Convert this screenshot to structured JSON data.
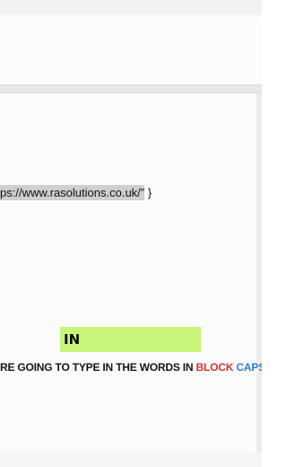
{
  "document": {
    "code_line_url": "ps://www.rasolutions.co.uk/”",
    "code_line_tail": " }"
  },
  "overlay": {
    "highlighted_word": "IN"
  },
  "caption": {
    "text_before": "RE GOING TO TYPE IN THE WORDS IN ",
    "highlight_red": "BLOCK",
    "space": " ",
    "highlight_blue": "CAPS"
  },
  "blurred_caption": {
    "text": "",
    "highlight": ""
  },
  "colors": {
    "highlight_box": "#c7f57a",
    "caption_red": "#d8332e",
    "caption_blue": "#2d7fd6"
  }
}
